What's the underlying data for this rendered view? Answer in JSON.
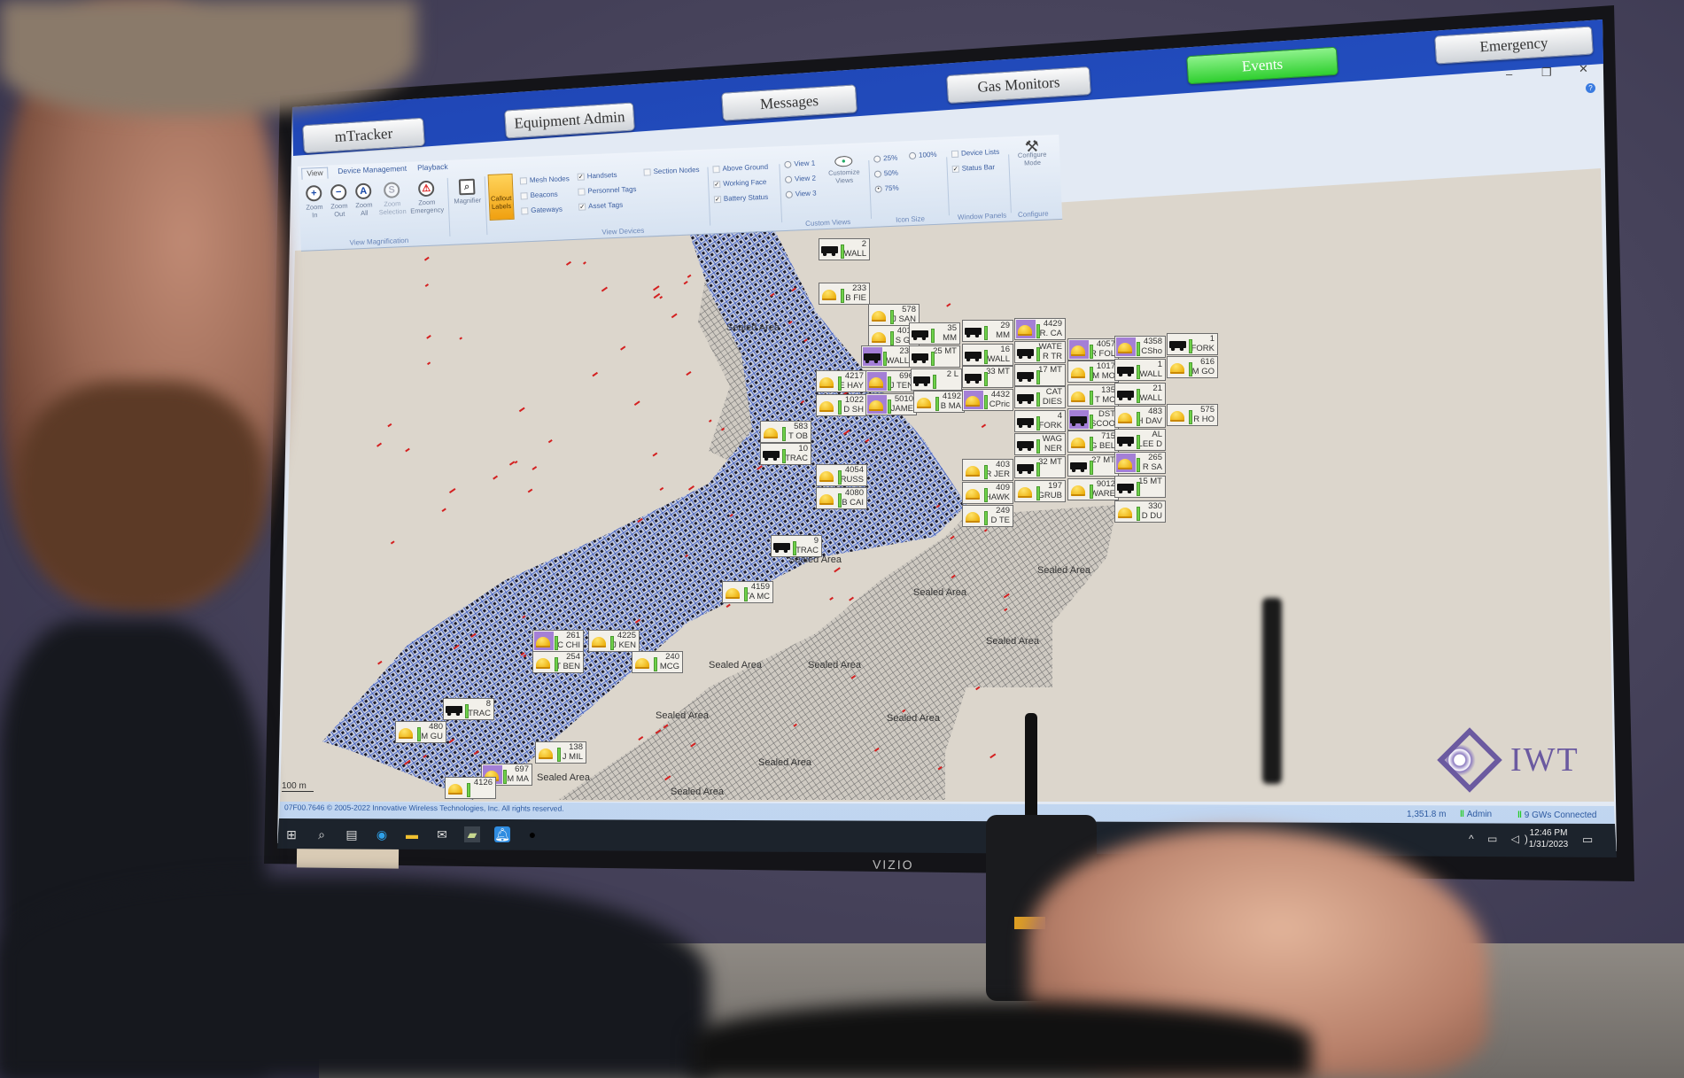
{
  "title_tabs": [
    {
      "label": "mTracker",
      "active": false
    },
    {
      "label": "Equipment Admin",
      "active": false
    },
    {
      "label": "Messages",
      "active": false
    },
    {
      "label": "Gas Monitors",
      "active": false
    },
    {
      "label": "Events",
      "active": true
    },
    {
      "label": "Emergency",
      "active": false
    }
  ],
  "window_controls": [
    "minimize-icon",
    "restore-icon",
    "close-icon",
    "help-icon"
  ],
  "ribbon": {
    "tabs": [
      "View",
      "Device Management",
      "Playback"
    ],
    "view_magnification": {
      "label": "View Magnification",
      "buttons": [
        {
          "line1": "Zoom",
          "line2": "In",
          "icon": "zoom-in-icon"
        },
        {
          "line1": "Zoom",
          "line2": "Out",
          "icon": "zoom-out-icon"
        },
        {
          "line1": "Zoom",
          "line2": "All",
          "icon": "zoom-all-icon"
        },
        {
          "line1": "Zoom",
          "line2": "Selection",
          "icon": "zoom-selection-icon"
        },
        {
          "line1": "Zoom",
          "line2": "Emergency",
          "icon": "zoom-emergency-icon"
        }
      ]
    },
    "magnifier": "Magnifier",
    "callout_labels": {
      "line1": "Callout",
      "line2": "Labels",
      "active": true
    },
    "view_devices": {
      "label": "View Devices",
      "items": [
        {
          "label": "Mesh Nodes",
          "checked": false
        },
        {
          "label": "Beacons",
          "checked": false
        },
        {
          "label": "Gateways",
          "checked": false
        },
        {
          "label": "Handsets",
          "checked": true
        },
        {
          "label": "Personnel Tags",
          "checked": false
        },
        {
          "label": "Asset Tags",
          "checked": true
        },
        {
          "label": "Section Nodes",
          "checked": false
        },
        {
          "label": "Above Ground",
          "checked": false
        },
        {
          "label": "Working Face",
          "checked": true
        },
        {
          "label": "Battery Status",
          "checked": true
        }
      ]
    },
    "custom_views": {
      "label": "Custom Views",
      "views": [
        {
          "label": "View 1",
          "selected": false
        },
        {
          "label": "View 2",
          "selected": false
        },
        {
          "label": "View 3",
          "selected": false
        }
      ],
      "customize": {
        "line1": "Customize",
        "line2": "Views"
      }
    },
    "icon_size": {
      "label": "Icon Size",
      "options": [
        {
          "label": "25%",
          "selected": false
        },
        {
          "label": "100%",
          "selected": false
        },
        {
          "label": "50%",
          "selected": false
        },
        {
          "label": "75%",
          "selected": true
        }
      ]
    },
    "window_panels": {
      "label": "Window Panels",
      "items": [
        {
          "label": "Device Lists",
          "checked": false
        },
        {
          "label": "Status Bar",
          "checked": true
        }
      ]
    },
    "configure": {
      "label": "Configure",
      "button_line1": "Configure",
      "button_line2": "Mode"
    }
  },
  "map": {
    "sealed_area_label": "Sealed Area",
    "scale_label": "100 m",
    "colors": {
      "active_network": "#2f4fb8",
      "sealed": "#7a7a7a",
      "alarm": "#d42020",
      "highlight": "#a47fd6",
      "helmet": "#f2c21a",
      "battery": "#6fd14a"
    },
    "callouts": [
      {
        "id": "2",
        "name": "WALL",
        "icon": "vehicle",
        "highlighted": false
      },
      {
        "id": "233",
        "name": "B FIE",
        "icon": "helmet",
        "highlighted": false
      },
      {
        "id": "578",
        "name": "J SAN",
        "icon": "helmet",
        "highlighted": false
      },
      {
        "id": "4013",
        "name": "S GR",
        "icon": "helmet",
        "highlighted": false
      },
      {
        "id": "35",
        "name": "MM",
        "icon": "vehicle",
        "highlighted": false
      },
      {
        "id": "29",
        "name": "MM",
        "icon": "vehicle",
        "highlighted": false
      },
      {
        "id": "4429",
        "name": "R. CA",
        "icon": "helmet",
        "highlighted": true
      },
      {
        "id": "23",
        "name": "WALL",
        "icon": "vehicle",
        "highlighted": true
      },
      {
        "id": "",
        "name": "25 MT",
        "icon": "vehicle",
        "highlighted": false
      },
      {
        "id": "16",
        "name": "WALL",
        "icon": "vehicle",
        "highlighted": false
      },
      {
        "id": "WATE",
        "name": "R TR",
        "icon": "vehicle",
        "highlighted": false
      },
      {
        "id": "4057",
        "name": "R FOL",
        "icon": "helmet",
        "highlighted": true
      },
      {
        "id": "4358",
        "name": "CSho",
        "icon": "helmet",
        "highlighted": true
      },
      {
        "id": "1",
        "name": "FORK",
        "icon": "vehicle",
        "highlighted": false
      },
      {
        "id": "4217",
        "name": "E HAY",
        "icon": "helmet",
        "highlighted": false
      },
      {
        "id": "696",
        "name": "J TEN",
        "icon": "helmet",
        "highlighted": true
      },
      {
        "id": "",
        "name": "2 L",
        "icon": "vehicle",
        "highlighted": false
      },
      {
        "id": "",
        "name": "33 MT",
        "icon": "vehicle",
        "highlighted": false
      },
      {
        "id": "",
        "name": "17 MT",
        "icon": "vehicle",
        "highlighted": false
      },
      {
        "id": "1017",
        "name": "M MO",
        "icon": "helmet",
        "highlighted": false
      },
      {
        "id": "1",
        "name": "WALL",
        "icon": "vehicle",
        "highlighted": false
      },
      {
        "id": "616",
        "name": "M GO",
        "icon": "helmet",
        "highlighted": false
      },
      {
        "id": "1022",
        "name": "D SH",
        "icon": "helmet",
        "highlighted": false
      },
      {
        "id": "5010",
        "name": "JAME",
        "icon": "helmet",
        "highlighted": true
      },
      {
        "id": "4192",
        "name": "B MA",
        "icon": "helmet",
        "highlighted": false
      },
      {
        "id": "4432",
        "name": "CPric",
        "icon": "helmet",
        "highlighted": true
      },
      {
        "id": "CAT",
        "name": "DIES",
        "icon": "vehicle",
        "highlighted": false
      },
      {
        "id": "135",
        "name": "T MC",
        "icon": "helmet",
        "highlighted": false
      },
      {
        "id": "21",
        "name": "WALL",
        "icon": "vehicle",
        "highlighted": false
      },
      {
        "id": "583",
        "name": "T OB",
        "icon": "helmet",
        "highlighted": false
      },
      {
        "id": "4",
        "name": "FORK",
        "icon": "vehicle",
        "highlighted": false
      },
      {
        "id": "DST",
        "name": "SCOO",
        "icon": "vehicle",
        "highlighted": true
      },
      {
        "id": "483",
        "name": "H DAV",
        "icon": "helmet",
        "highlighted": false
      },
      {
        "id": "575",
        "name": "R HO",
        "icon": "helmet",
        "highlighted": false
      },
      {
        "id": "10",
        "name": "TRAC",
        "icon": "vehicle",
        "highlighted": false
      },
      {
        "id": "WAG",
        "name": "NER",
        "icon": "vehicle",
        "highlighted": false
      },
      {
        "id": "715",
        "name": "G BEL",
        "icon": "helmet",
        "highlighted": false
      },
      {
        "id": "AL",
        "name": "LEE D",
        "icon": "vehicle",
        "highlighted": false
      },
      {
        "id": "4054",
        "name": "RUSS",
        "icon": "helmet",
        "highlighted": false
      },
      {
        "id": "403",
        "name": "R JER",
        "icon": "helmet",
        "highlighted": false
      },
      {
        "id": "",
        "name": "32 MT",
        "icon": "vehicle",
        "highlighted": false
      },
      {
        "id": "",
        "name": "27 MT",
        "icon": "vehicle",
        "highlighted": false
      },
      {
        "id": "265",
        "name": "R SA",
        "icon": "helmet",
        "highlighted": true
      },
      {
        "id": "4080",
        "name": "B CAI",
        "icon": "helmet",
        "highlighted": false
      },
      {
        "id": "409",
        "name": "HAWK",
        "icon": "helmet",
        "highlighted": false
      },
      {
        "id": "197",
        "name": "GRUB",
        "icon": "helmet",
        "highlighted": false
      },
      {
        "id": "9012",
        "name": "WARE",
        "icon": "helmet",
        "highlighted": false
      },
      {
        "id": "",
        "name": "15 MT",
        "icon": "vehicle",
        "highlighted": false
      },
      {
        "id": "249",
        "name": "D TE",
        "icon": "helmet",
        "highlighted": false
      },
      {
        "id": "330",
        "name": "D DU",
        "icon": "helmet",
        "highlighted": false
      },
      {
        "id": "9",
        "name": "TRAC",
        "icon": "vehicle",
        "highlighted": false
      },
      {
        "id": "4159",
        "name": "TA MC",
        "icon": "helmet",
        "highlighted": false
      },
      {
        "id": "261",
        "name": "C CHI",
        "icon": "helmet",
        "highlighted": true
      },
      {
        "id": "4225",
        "name": "J KEN",
        "icon": "helmet",
        "highlighted": false
      },
      {
        "id": "254",
        "name": "T BEN",
        "icon": "helmet",
        "highlighted": false
      },
      {
        "id": "240",
        "name": "MCG",
        "icon": "helmet",
        "highlighted": false
      },
      {
        "id": "8",
        "name": "TRAC",
        "icon": "vehicle",
        "highlighted": false
      },
      {
        "id": "480",
        "name": "M GU",
        "icon": "helmet",
        "highlighted": false
      },
      {
        "id": "138",
        "name": "J MIL",
        "icon": "helmet",
        "highlighted": false
      },
      {
        "id": "697",
        "name": "M MA",
        "icon": "helmet",
        "highlighted": true
      },
      {
        "id": "4126",
        "name": "",
        "icon": "helmet",
        "highlighted": false
      }
    ]
  },
  "logo": {
    "text": "IWT"
  },
  "status_bar": {
    "copyright": "07F00.7646 © 2005-2022 Innovative Wireless Technologies, Inc. All rights reserved.",
    "distance": "1,351.8 m",
    "user": "Admin",
    "gateways": "9 GWs Connected"
  },
  "taskbar": {
    "icons": [
      "windows-start-icon",
      "search-icon",
      "task-view-icon",
      "edge-icon",
      "file-explorer-icon",
      "mail-icon",
      "sticky-notes-icon",
      "notification-app-icon",
      "user-app-icon"
    ],
    "time": "12:46 PM",
    "date": "1/31/2023"
  },
  "monitor": {
    "brand": "VIZIO"
  }
}
